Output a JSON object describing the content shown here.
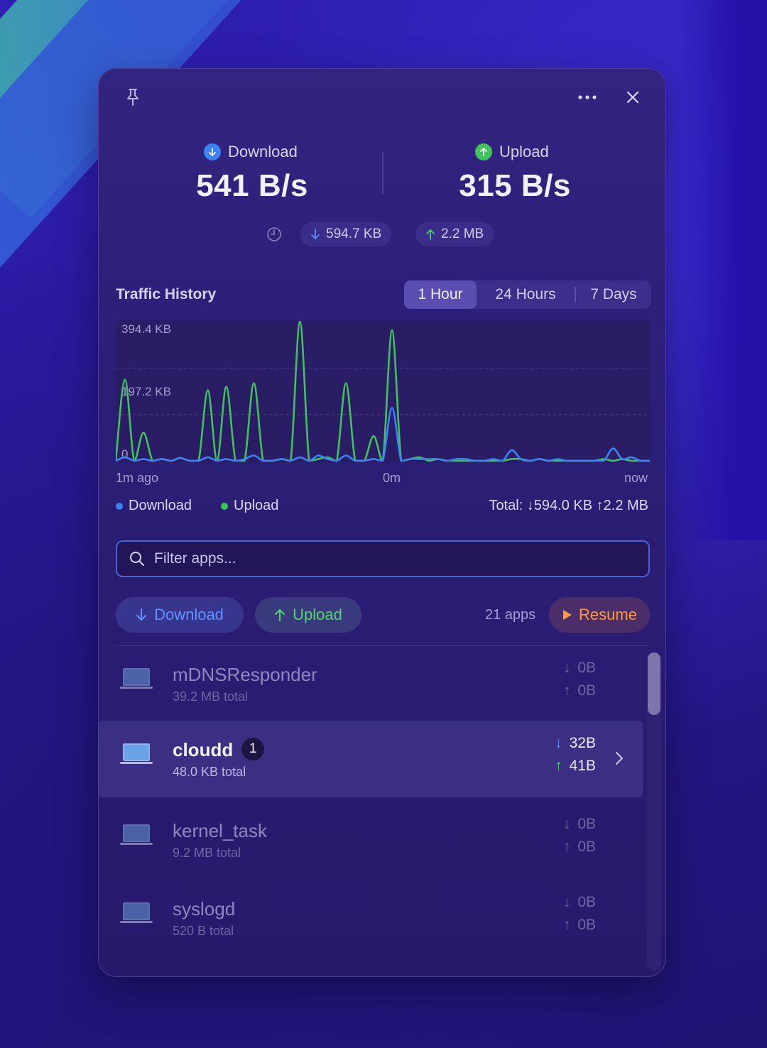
{
  "header": {
    "pin_icon": "pin-icon",
    "more_icon": "ellipsis-icon",
    "close_icon": "close-icon"
  },
  "download": {
    "label": "Download",
    "value": "541 B/s",
    "color": "#3b82f6"
  },
  "upload": {
    "label": "Upload",
    "value": "315 B/s",
    "color": "#3ec45a"
  },
  "totals_chips": {
    "download": "594.7 KB",
    "upload": "2.2 MB"
  },
  "traffic_history": {
    "title": "Traffic History",
    "ranges": [
      "1 Hour",
      "24 Hours",
      "7 Days"
    ],
    "selected_range": "1 Hour"
  },
  "chart_data": {
    "type": "line",
    "ylabels": [
      "394.4 KB",
      "197.2 KB",
      "0"
    ],
    "ylim": [
      0,
      394.4
    ],
    "yunit": "KB",
    "xlabels": [
      "1m ago",
      "0m",
      "now"
    ],
    "series": [
      {
        "name": "Upload",
        "color": "#3ec45a",
        "values": [
          0,
          230,
          0,
          80,
          0,
          5,
          0,
          8,
          0,
          0,
          200,
          0,
          210,
          0,
          0,
          220,
          0,
          0,
          5,
          0,
          394,
          0,
          5,
          10,
          0,
          220,
          0,
          0,
          70,
          0,
          370,
          0,
          5,
          10,
          0,
          5,
          0,
          0,
          0,
          0,
          0,
          0,
          0,
          5,
          5,
          0,
          5,
          0,
          0,
          0,
          0,
          0,
          0,
          5,
          0,
          5,
          0,
          0,
          0
        ]
      },
      {
        "name": "Download",
        "color": "#3b82f6",
        "values": [
          0,
          10,
          0,
          5,
          0,
          5,
          0,
          8,
          0,
          0,
          10,
          0,
          5,
          0,
          5,
          15,
          0,
          0,
          5,
          0,
          10,
          0,
          15,
          5,
          0,
          15,
          0,
          0,
          5,
          0,
          150,
          0,
          5,
          5,
          5,
          5,
          0,
          5,
          5,
          0,
          0,
          5,
          0,
          30,
          5,
          0,
          5,
          0,
          5,
          0,
          0,
          0,
          0,
          0,
          35,
          5,
          10,
          0,
          0
        ]
      }
    ],
    "legend": [
      "Download",
      "Upload"
    ],
    "legend_position": "bottom-left",
    "total_text": "Total: ↓594.0 KB ↑2.2 MB"
  },
  "filter": {
    "placeholder": "Filter apps..."
  },
  "sort_buttons": {
    "download": "Download",
    "upload": "Upload"
  },
  "apps_count": "21 apps",
  "resume_label": "Resume",
  "apps": [
    {
      "name": "mDNSResponder",
      "total": "39.2 MB total",
      "down": "0B",
      "up": "0B"
    },
    {
      "name": "cloudd",
      "badge": "1",
      "total": "48.0 KB total",
      "down": "32B",
      "up": "41B"
    },
    {
      "name": "kernel_task",
      "total": "9.2 MB total",
      "down": "0B",
      "up": "0B"
    },
    {
      "name": "syslogd",
      "total": "520 B total",
      "down": "0B",
      "up": "0B"
    }
  ]
}
